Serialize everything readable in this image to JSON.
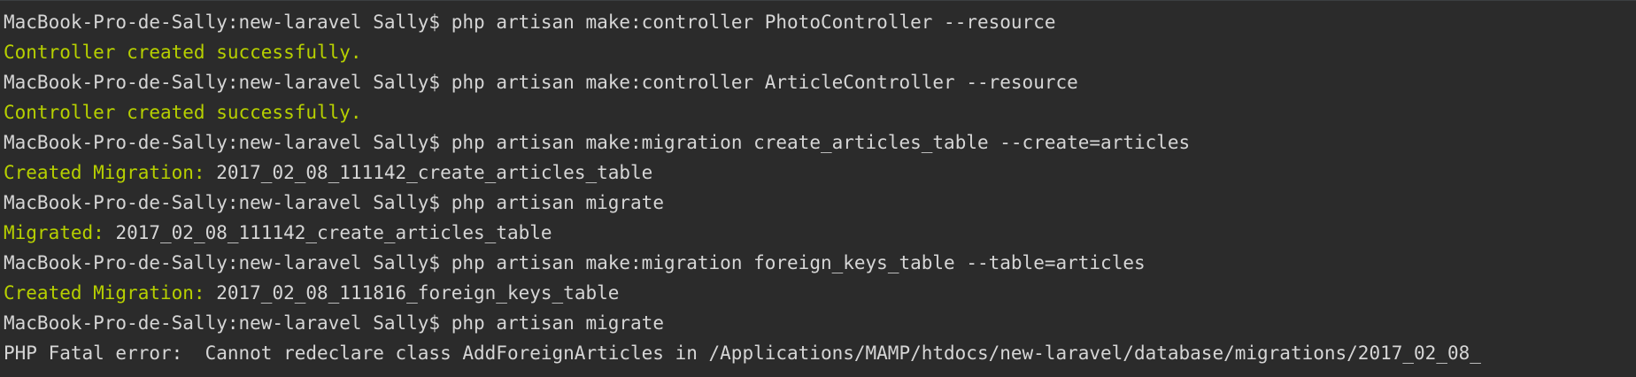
{
  "terminal": {
    "prompt": "MacBook-Pro-de-Sally:new-laravel Sally$",
    "lines": [
      {
        "kind": "command",
        "text": "php artisan make:controller PhotoController --resource"
      },
      {
        "kind": "success",
        "label": "Controller created successfully.",
        "value": ""
      },
      {
        "kind": "command",
        "text": "php artisan make:controller ArticleController --resource"
      },
      {
        "kind": "success",
        "label": "Controller created successfully.",
        "value": ""
      },
      {
        "kind": "command",
        "text": "php artisan make:migration create_articles_table --create=articles"
      },
      {
        "kind": "success",
        "label": "Created Migration:",
        "value": "2017_02_08_111142_create_articles_table"
      },
      {
        "kind": "command",
        "text": "php artisan migrate"
      },
      {
        "kind": "success",
        "label": "Migrated:",
        "value": "2017_02_08_111142_create_articles_table"
      },
      {
        "kind": "command",
        "text": "php artisan make:migration foreign_keys_table --table=articles"
      },
      {
        "kind": "success",
        "label": "Created Migration:",
        "value": "2017_02_08_111816_foreign_keys_table"
      },
      {
        "kind": "command",
        "text": "php artisan migrate"
      },
      {
        "kind": "error",
        "text": "PHP Fatal error:  Cannot redeclare class AddForeignArticles in /Applications/MAMP/htdocs/new-laravel/database/migrations/2017_02_08_"
      }
    ],
    "colors": {
      "background": "#2b2b2b",
      "text": "#d6d6d6",
      "success": "#b7d000"
    }
  }
}
